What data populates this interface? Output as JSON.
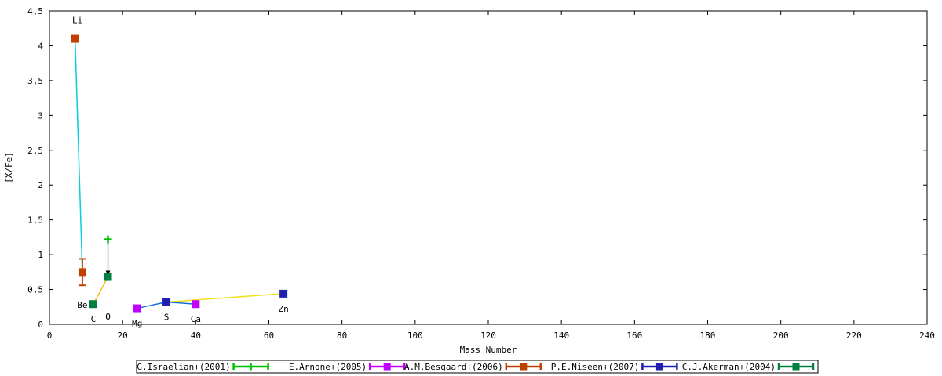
{
  "chart_data": {
    "type": "scatter",
    "title": "",
    "xlabel": "Mass Number",
    "ylabel": "[X/Fe]",
    "xlim": [
      0,
      240
    ],
    "ylim": [
      0,
      4.5
    ],
    "xticks": [
      0,
      20,
      40,
      60,
      80,
      100,
      120,
      140,
      160,
      180,
      200,
      220,
      240
    ],
    "xtick_labels": [
      "0",
      "20",
      "40",
      "60",
      "80",
      "100",
      "120",
      "140",
      "160",
      "180",
      "200",
      "220",
      "240"
    ],
    "yticks": [
      0,
      0.5,
      1,
      1.5,
      2,
      2.5,
      3,
      3.5,
      4,
      4.5
    ],
    "ytick_labels": [
      "0",
      "0,5",
      "1",
      "1,5",
      "2",
      "2,5",
      "3",
      "3,5",
      "4",
      "4,5"
    ],
    "grid": false,
    "legend_position": "bottom",
    "series": [
      {
        "name": "G.Israelian+(2001)",
        "color": "#00c000",
        "marker": "plus",
        "points": [
          {
            "x": 16,
            "y": 1.22
          }
        ]
      },
      {
        "name": "E.Arnone+(2005)",
        "color": "#c000ff",
        "marker": "square",
        "points": [
          {
            "x": 24,
            "y": 0.23
          },
          {
            "x": 40,
            "y": 0.29
          }
        ]
      },
      {
        "name": "A.M.Besgaard+(2006)",
        "color": "#c04000",
        "marker": "square",
        "points": [
          {
            "x": 7,
            "y": 4.1
          },
          {
            "x": 9,
            "y": 0.75,
            "err_low": 0.56,
            "err_high": 0.94
          }
        ]
      },
      {
        "name": "P.E.Niseen+(2007)",
        "color": "#2020b0",
        "marker": "square",
        "points": [
          {
            "x": 32,
            "y": 0.32
          },
          {
            "x": 64,
            "y": 0.44
          }
        ]
      },
      {
        "name": "C.J.Akerman+(2004)",
        "color": "#008040",
        "marker": "square",
        "points": [
          {
            "x": 12,
            "y": 0.29
          },
          {
            "x": 16,
            "y": 0.68
          }
        ]
      }
    ],
    "connectors": [
      {
        "color": "#00d0e0",
        "points": [
          {
            "x": 7,
            "y": 4.1
          },
          {
            "x": 9,
            "y": 0.75
          }
        ]
      },
      {
        "color": "#f0c020",
        "points": [
          {
            "x": 12,
            "y": 0.29
          },
          {
            "x": 16,
            "y": 0.68
          }
        ]
      },
      {
        "color": "#f0e020",
        "points": [
          {
            "x": 32,
            "y": 0.32
          },
          {
            "x": 64,
            "y": 0.44
          }
        ]
      },
      {
        "color": "#1070d0",
        "points": [
          {
            "x": 24,
            "y": 0.23
          },
          {
            "x": 32,
            "y": 0.32
          },
          {
            "x": 40,
            "y": 0.29
          }
        ]
      }
    ],
    "arrow": {
      "color": "#000000",
      "from": {
        "x": 16,
        "y": 1.22
      },
      "to": {
        "x": 16,
        "y": 0.68
      }
    },
    "element_labels": [
      {
        "text": "Li",
        "x": 7,
        "y": 4.1,
        "pos": "above"
      },
      {
        "text": "Be",
        "x": 9,
        "y": 0.29,
        "pos": "right-of-point"
      },
      {
        "text": "C",
        "x": 12,
        "y": 0.29,
        "pos": "below"
      },
      {
        "text": "O",
        "x": 16,
        "y": 0.68,
        "pos": "below-axis"
      },
      {
        "text": "Mg",
        "x": 24,
        "y": 0.23,
        "pos": "below"
      },
      {
        "text": "S",
        "x": 32,
        "y": 0.32,
        "pos": "below"
      },
      {
        "text": "Ca",
        "x": 40,
        "y": 0.29,
        "pos": "below"
      },
      {
        "text": "Zn",
        "x": 64,
        "y": 0.44,
        "pos": "below"
      }
    ]
  }
}
